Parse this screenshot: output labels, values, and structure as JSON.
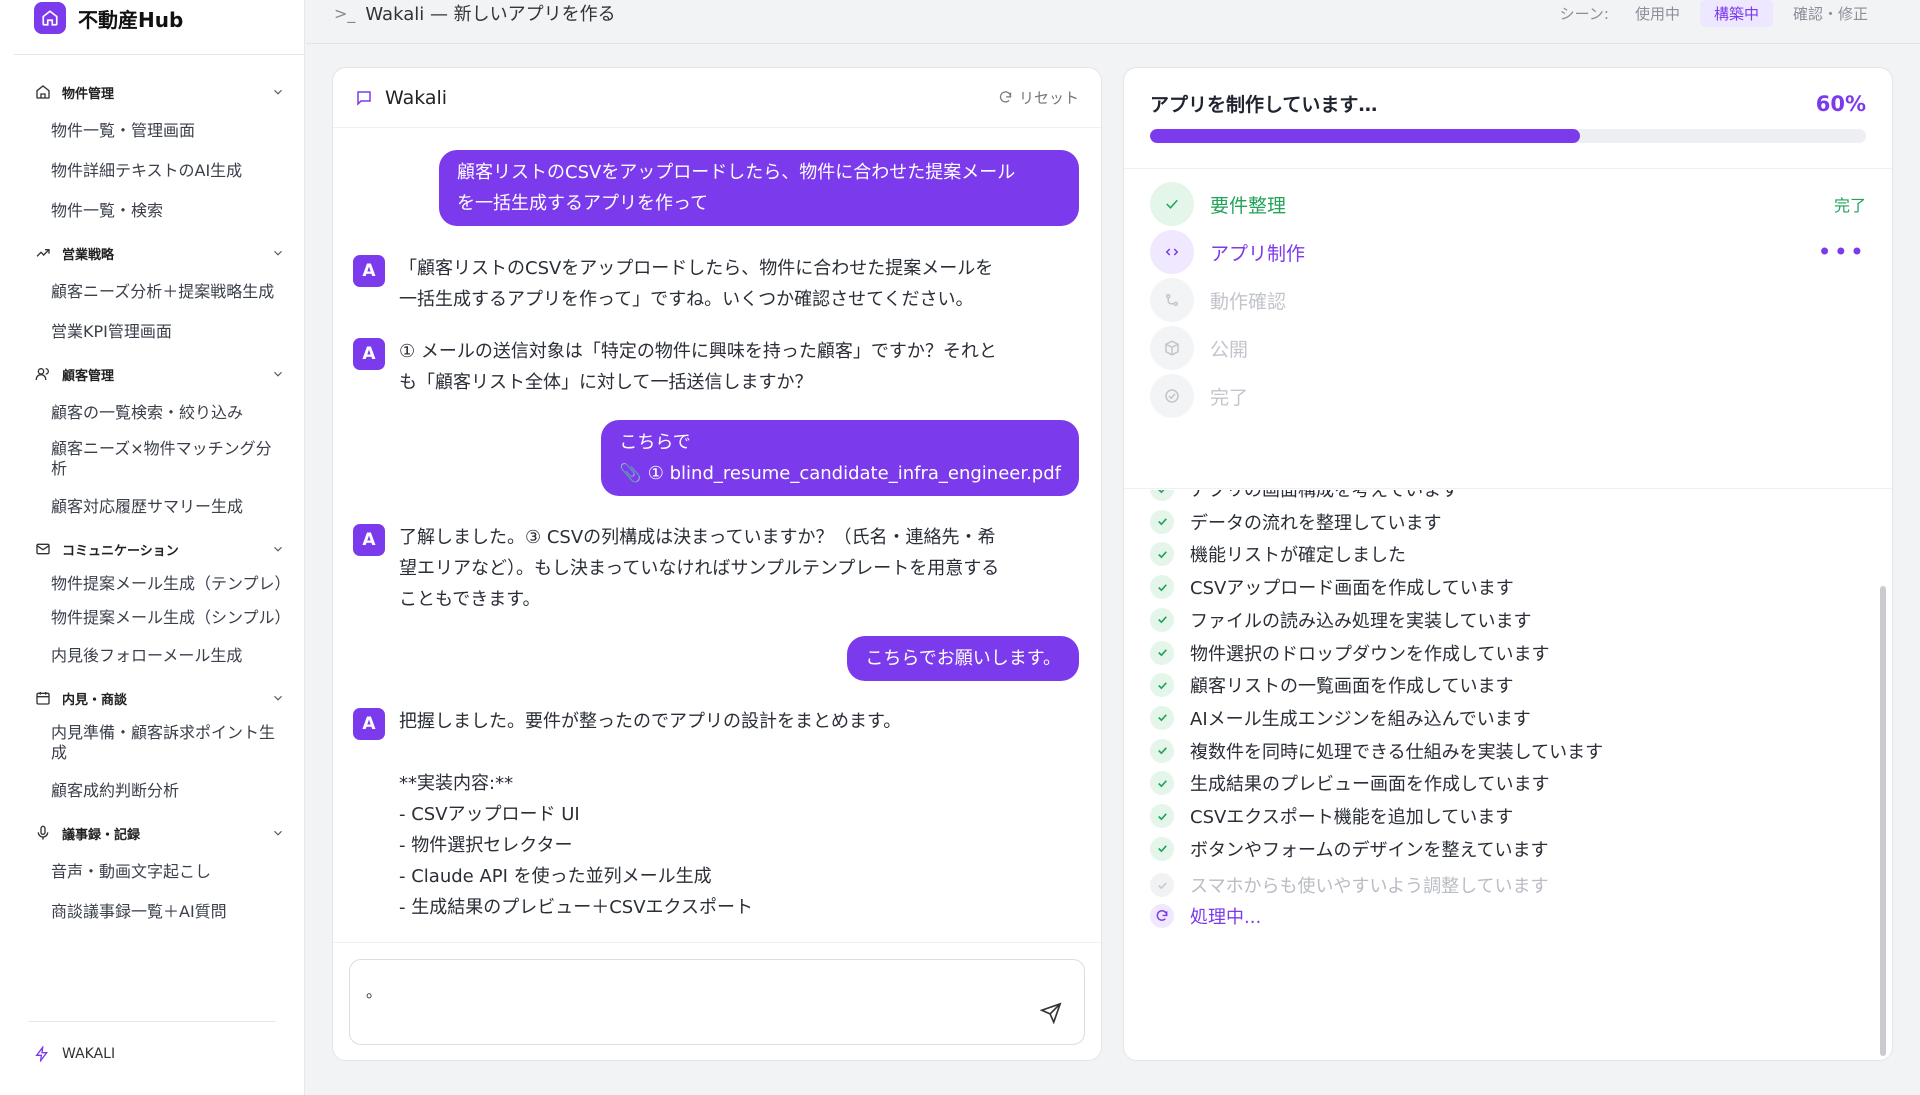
{
  "brand": {
    "name": "不動産Hub",
    "logo_icon": "home-icon",
    "accent": "#7c3aed"
  },
  "sidebar": {
    "sections": [
      {
        "key": "property",
        "icon": "home-icon",
        "label": "物件管理",
        "items": [
          "物件一覧・管理画面",
          "物件詳細テキストのAI生成",
          "物件一覧・検索"
        ]
      },
      {
        "key": "sales",
        "icon": "trending-up-icon",
        "label": "営業戦略",
        "items": [
          "顧客ニーズ分析＋提案戦略生成",
          "営業KPI管理画面"
        ]
      },
      {
        "key": "customer",
        "icon": "users-icon",
        "label": "顧客管理",
        "items": [
          "顧客の一覧検索・絞り込み",
          "顧客ニーズ×物件マッチング分析",
          "顧客対応履歴サマリー生成"
        ]
      },
      {
        "key": "comm",
        "icon": "mail-icon",
        "label": "コミュニケーション",
        "items": [
          "物件提案メール生成（テンプレ）",
          "物件提案メール生成（シンプル）",
          "内見後フォローメール生成"
        ]
      },
      {
        "key": "viewing",
        "icon": "calendar-icon",
        "label": "内見・商談",
        "items": [
          "内見準備・顧客訴求ポイント生成",
          "顧客成約判断分析"
        ]
      },
      {
        "key": "minutes",
        "icon": "mic-icon",
        "label": "議事録・記録",
        "items": [
          "音声・動画文字起こし",
          "商談議事録一覧＋AI質問"
        ]
      }
    ],
    "footer": {
      "label": "WAKALI",
      "icon": "bolt-icon"
    }
  },
  "topbar": {
    "title": "Wakali — 新しいアプリを作る",
    "scene_label": "シーン:",
    "scenes": [
      "使用中",
      "構築中",
      "確認・修正"
    ],
    "active_scene": "構築中"
  },
  "chat": {
    "title": "Wakali",
    "reset_label": "リセット",
    "messages": [
      {
        "role": "user",
        "text": "顧客リストのCSVをアップロードしたら、物件に合わせた提案メール\nを一括生成するアプリを作って"
      },
      {
        "role": "assistant",
        "avatar": "A",
        "text": "「顧客リストのCSVをアップロードしたら、物件に合わせた提案メールを\n一括生成するアプリを作って」ですね。いくつか確認させてください。"
      },
      {
        "role": "assistant",
        "avatar": "A",
        "text": "① メールの送信対象は「特定の物件に興味を持った顧客」ですか？それと\nも「顧客リスト全体」に対して一括送信しますか？"
      },
      {
        "role": "user",
        "text": "こちらで",
        "attachment": "① blind_resume_candidate_infra_engineer.pdf"
      },
      {
        "role": "assistant",
        "avatar": "A",
        "text": "了解しました。③ CSVの列構成は決まっていますか？（氏名・連絡先・希\n望エリアなど）。もし決まっていなければサンプルテンプレートを用意する\nこともできます。"
      },
      {
        "role": "user",
        "text": "こちらでお願いします。"
      },
      {
        "role": "assistant",
        "avatar": "A",
        "text": "把握しました。要件が整ったのでアプリの設計をまとめます。\n\n**実装内容:**\n- CSVアップロード UI\n- 物件選択セレクター\n- Claude API を使った並列メール生成\n- 生成結果のプレビュー＋CSVエクスポート"
      }
    ],
    "input_value": "。"
  },
  "progress": {
    "title": "アプリを制作しています…",
    "percent_label": "60%",
    "percent": 60,
    "steps": [
      {
        "label": "要件整理",
        "status": "done",
        "status_label": "完了"
      },
      {
        "label": "アプリ制作",
        "status": "active",
        "status_label": "•••"
      },
      {
        "label": "動作確認",
        "status": "pending"
      },
      {
        "label": "公開",
        "status": "pending"
      },
      {
        "label": "完了",
        "status": "pending"
      }
    ],
    "logs": [
      {
        "text": "アプリの画面構成を考えています",
        "state": "done"
      },
      {
        "text": "データの流れを整理しています",
        "state": "done"
      },
      {
        "text": "機能リストが確定しました",
        "state": "done"
      },
      {
        "text": "CSVアップロード画面を作成しています",
        "state": "done"
      },
      {
        "text": "ファイルの読み込み処理を実装しています",
        "state": "done"
      },
      {
        "text": "物件選択のドロップダウンを作成しています",
        "state": "done"
      },
      {
        "text": "顧客リストの一覧画面を作成しています",
        "state": "done"
      },
      {
        "text": "AIメール生成エンジンを組み込んでいます",
        "state": "done"
      },
      {
        "text": "複数件を同時に処理できる仕組みを実装しています",
        "state": "done"
      },
      {
        "text": "生成結果のプレビュー画面を作成しています",
        "state": "done"
      },
      {
        "text": "CSVエクスポート機能を追加しています",
        "state": "done"
      },
      {
        "text": "ボタンやフォームのデザインを整えています",
        "state": "done"
      },
      {
        "text": "スマホからも使いやすいよう調整しています",
        "state": "pending"
      },
      {
        "text": "処理中...",
        "state": "processing"
      }
    ]
  },
  "colors": {
    "accent": "#7c3aed",
    "success": "#22a35a",
    "muted": "#c2c5cc"
  }
}
